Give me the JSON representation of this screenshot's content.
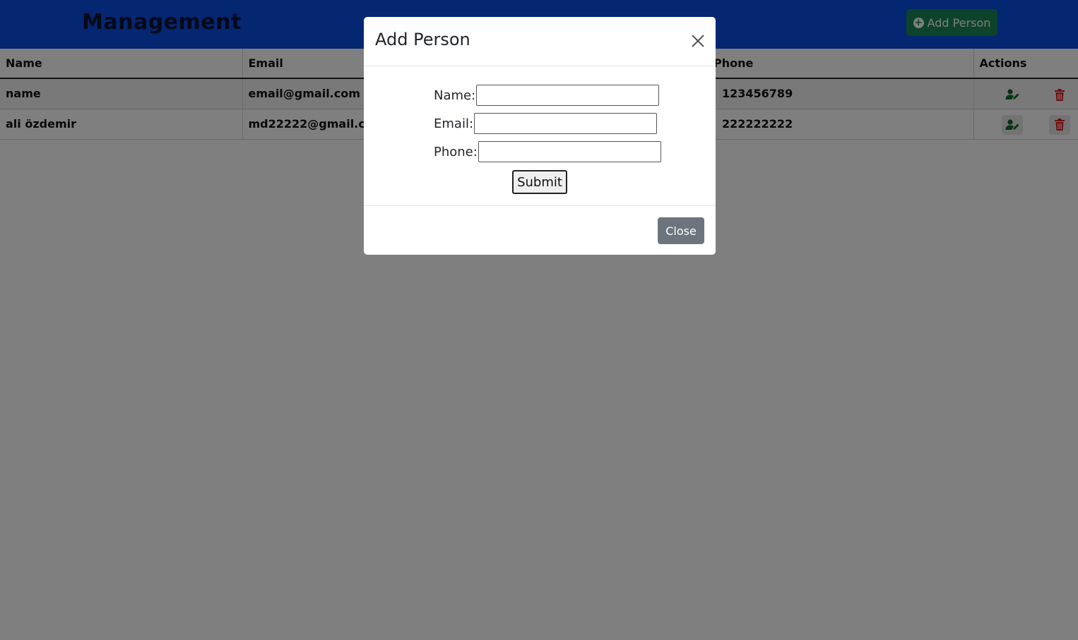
{
  "header": {
    "title": "Management",
    "add_button_label": "Add Person",
    "add_icon": "plus-circle-icon"
  },
  "table": {
    "columns": [
      "Name",
      "Email",
      "Phone",
      "Actions"
    ],
    "rows": [
      {
        "name": "name",
        "email": "email@gmail.com",
        "phone": "123456789"
      },
      {
        "name": "ali özdemir",
        "email": "md22222@gmail.com",
        "phone": "222222222"
      }
    ],
    "action_icons": [
      "edit-user-icon",
      "trash-icon"
    ]
  },
  "modal": {
    "title": "Add Person",
    "fields": {
      "name_label": "Name:",
      "name_value": "",
      "email_label": "Email:",
      "email_value": "",
      "phone_label": "Phone:",
      "phone_value": ""
    },
    "submit_label": "Submit",
    "close_label": "Close"
  },
  "colors": {
    "header_bg": "#0a4ce2",
    "add_button": "#198754",
    "close_button": "#6c757d",
    "edit_icon": "#0f6b28",
    "delete_icon": "#dc1c1c"
  }
}
